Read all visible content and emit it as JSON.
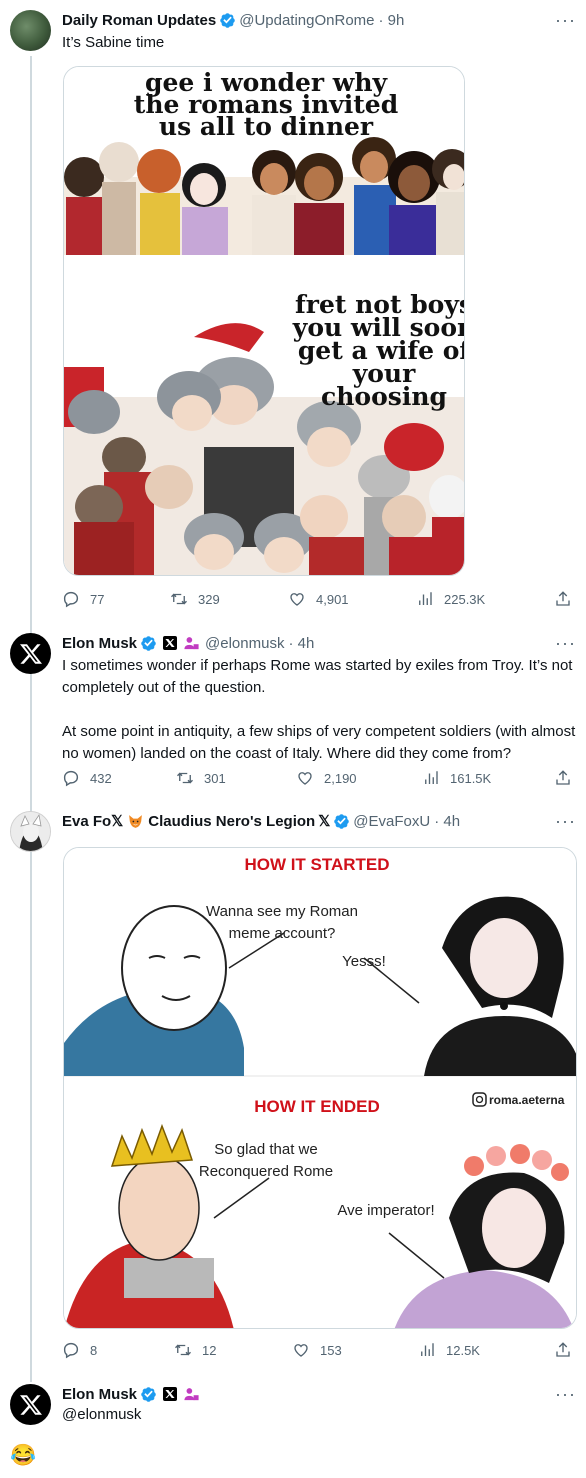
{
  "tweets": [
    {
      "display_name": "Daily Roman Updates",
      "handle": "@UpdatingOnRome",
      "time": "· 9h",
      "text": "It’s Sabine time",
      "media_captions": {
        "top": [
          "gee i wonder why",
          "the romans invited",
          "us all to dinner"
        ],
        "bottom": [
          "fret not boys",
          "you will soon",
          "get a wife of",
          "your",
          "choosing"
        ]
      },
      "stats": {
        "replies": "77",
        "reposts": "329",
        "likes": "4,901",
        "views": "225.3K"
      }
    },
    {
      "display_name": "Elon Musk",
      "handle": "@elonmusk",
      "time": "· 4h",
      "text": "I sometimes wonder if perhaps Rome was started by exiles from Troy. It’s not completely out of the question.\n\nAt some point in antiquity, a few ships of very competent soldiers (with almost no women) landed on the coast of Italy. Where did they come from?",
      "stats": {
        "replies": "432",
        "reposts": "301",
        "likes": "2,190",
        "views": "161.5K"
      }
    },
    {
      "display_name_a": "Eva Fo𝕏",
      "display_name_b": "Claudius Nero's Legion",
      "display_name_c": "𝕏",
      "handle": "@EvaFoxU",
      "time": "· 4h",
      "media_captions": {
        "started": "HOW IT STARTED",
        "ended": "HOW IT ENDED",
        "q1": [
          "Wanna see my Roman",
          "meme account?"
        ],
        "a1": "Yesss!",
        "q2": [
          "So glad that we",
          "Reconquered Rome"
        ],
        "a2": "Ave imperator!",
        "watermark": "roma.aeterna"
      },
      "stats": {
        "replies": "8",
        "reposts": "12",
        "likes": "153",
        "views": "12.5K"
      }
    },
    {
      "display_name": "Elon Musk",
      "handle": "@elonmusk",
      "text": "😂"
    }
  ],
  "more_label": "···",
  "colors": {
    "verified": "#1d9bf0",
    "affiliate": "#c13cc1",
    "muted": "#536471",
    "line": "#cfd9de"
  }
}
